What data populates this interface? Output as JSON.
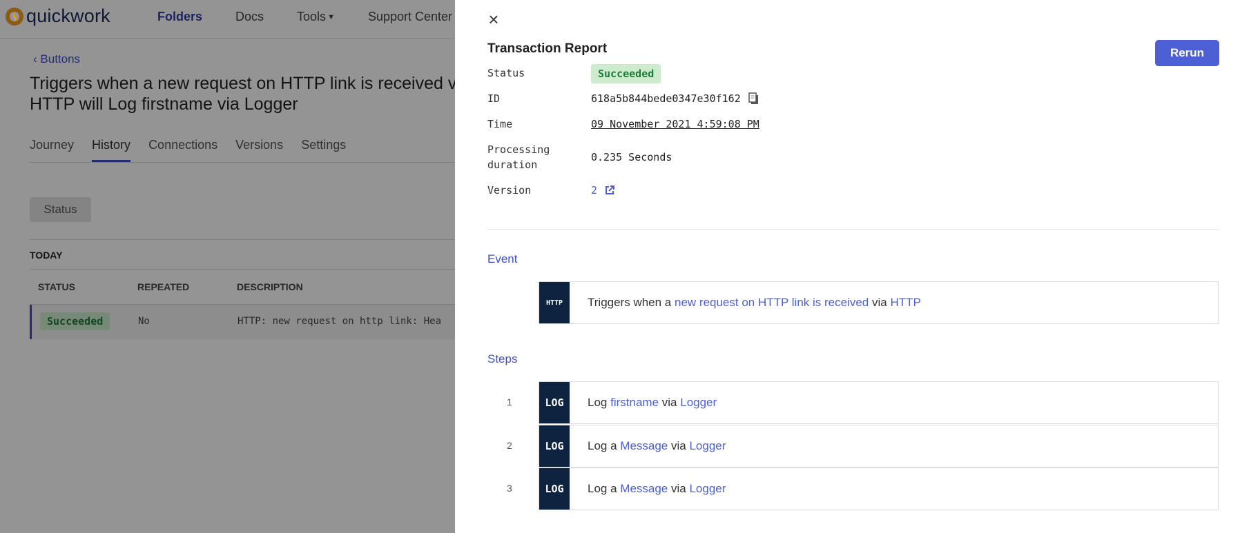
{
  "app": {
    "logo_text": "quickwork",
    "nav": [
      {
        "label": "Folders",
        "active": true
      },
      {
        "label": "Docs",
        "active": false
      },
      {
        "label": "Tools",
        "active": false
      },
      {
        "label": "Support Center",
        "active": false
      }
    ],
    "breadcrumb": "Buttons",
    "page_title": "Triggers when a new request on HTTP link is received via HTTP will Log firstname via Logger",
    "tabs": [
      "Journey",
      "History",
      "Connections",
      "Versions",
      "Settings"
    ],
    "active_tab": "History",
    "filter_label": "Status",
    "group_label": "TODAY",
    "table": {
      "columns": [
        "STATUS",
        "REPEATED",
        "DESCRIPTION"
      ],
      "rows": [
        {
          "status": "Succeeded",
          "repeated": "No",
          "description": "HTTP: new request on http link: Hea"
        }
      ]
    }
  },
  "drawer": {
    "title": "Transaction Report",
    "rerun_label": "Rerun",
    "meta": {
      "status_label": "Status",
      "status_value": "Succeeded",
      "id_label": "ID",
      "id_value": "618a5b844bede0347e30f162",
      "time_label": "Time",
      "time_value": "09 November 2021 4:59:08 PM",
      "duration_label_1": "Processing",
      "duration_label_2": "duration",
      "duration_value": "0.235 Seconds",
      "version_label": "Version",
      "version_value": "2"
    },
    "event": {
      "heading": "Event",
      "icon_label": "HTTP",
      "prefix": "Triggers when a",
      "trigger_link": "new request on HTTP link is received",
      "via": "via",
      "app_link": "HTTP"
    },
    "steps": {
      "heading": "Steps",
      "items": [
        {
          "num": "1",
          "icon_label": "LOG",
          "prefix": "Log",
          "field_link": "firstname",
          "via": "via",
          "app_link": "Logger"
        },
        {
          "num": "2",
          "icon_label": "LOG",
          "prefix": "Log a",
          "field_link": "Message",
          "via": "via",
          "app_link": "Logger"
        },
        {
          "num": "3",
          "icon_label": "LOG",
          "prefix": "Log a",
          "field_link": "Message",
          "via": "via",
          "app_link": "Logger"
        }
      ]
    }
  },
  "colors": {
    "accent": "#4c5fd5",
    "success_bg": "#cdeccd",
    "success_text": "#1f7a3a",
    "icon_bg": "#0e2340"
  }
}
